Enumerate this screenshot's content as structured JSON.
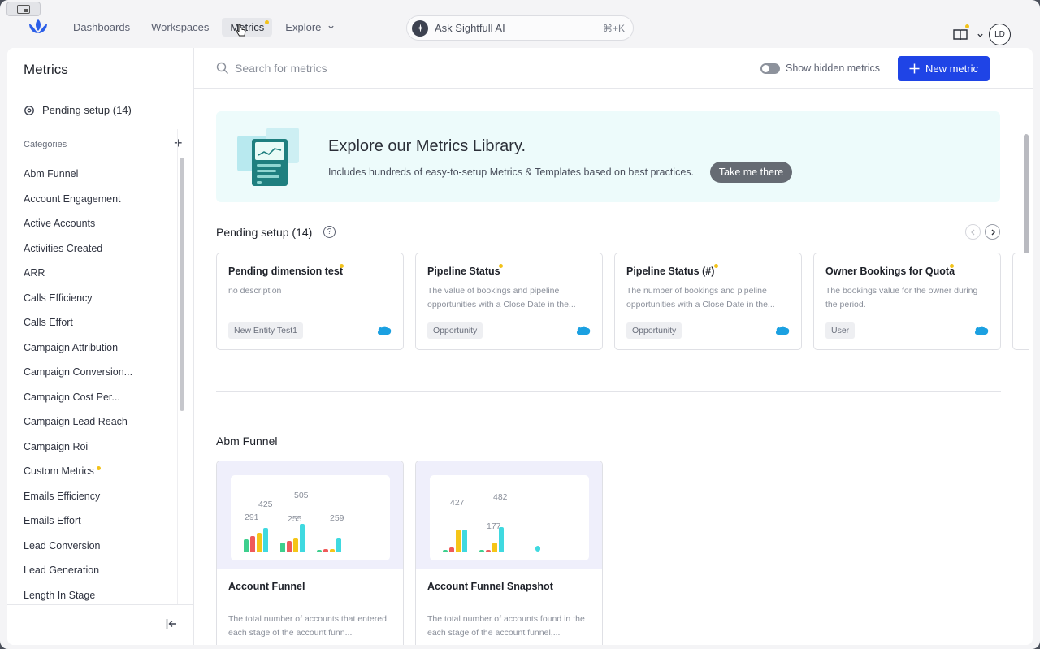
{
  "nav": {
    "links": [
      "Dashboards",
      "Workspaces",
      "Metrics",
      "Explore"
    ],
    "ask_label": "Ask Sightfull AI",
    "ask_shortcut": "⌘+K",
    "avatar_initials": "LD"
  },
  "sidebar": {
    "title": "Metrics",
    "pending": "Pending setup (14)",
    "categories_heading": "Categories",
    "items": [
      "Abm Funnel",
      "Account Engagement",
      "Active Accounts",
      "Activities Created",
      "ARR",
      "Calls Efficiency",
      "Calls Effort",
      "Campaign Attribution",
      "Campaign Conversion...",
      "Campaign Cost Per...",
      "Campaign Lead Reach",
      "Campaign Roi",
      "Custom Metrics",
      "Emails Efficiency",
      "Emails Effort",
      "Lead Conversion",
      "Lead Generation",
      "Length In Stage"
    ]
  },
  "toolbar": {
    "search_placeholder": "Search for metrics",
    "hidden_label": "Show hidden metrics",
    "new_metric": "New metric"
  },
  "banner": {
    "title": "Explore our Metrics Library.",
    "subtitle": "Includes hundreds of easy-to-setup Metrics & Templates based on best practices.",
    "button": "Take me there"
  },
  "pending_section": {
    "title": "Pending setup (14)",
    "cards": [
      {
        "title": "Pending dimension test",
        "desc": "no description",
        "tag": "New Entity Test1"
      },
      {
        "title": "Pipeline Status",
        "desc": "The value of bookings and pipeline opportunities with a Close Date in the...",
        "tag": "Opportunity"
      },
      {
        "title": "Pipeline Status (#)",
        "desc": "The number of bookings and pipeline opportunities with a Close Date in the...",
        "tag": "Opportunity"
      },
      {
        "title": "Owner Bookings for Quota",
        "desc": "The bookings value for the owner during the period.",
        "tag": "User"
      }
    ]
  },
  "abm_section": {
    "title": "Abm Funnel",
    "cards": [
      {
        "title": "Account Funnel",
        "desc": "The total number of accounts that entered each stage of the account funn...",
        "labels": [
          "425",
          "505",
          "291",
          "255",
          "259"
        ]
      },
      {
        "title": "Account Funnel Snapshot",
        "desc": "The total number of accounts found in the each stage of the account funnel,...",
        "labels": [
          "427",
          "482",
          "177"
        ]
      }
    ]
  },
  "colors": {
    "accent": "#1f44e6",
    "banner_bg": "#edfbfb",
    "dot": "#f2c21a",
    "bar_green": "#3ecf8e",
    "bar_red": "#ef5a5a",
    "bar_yellow": "#f5c518",
    "bar_cyan": "#3fd9e0"
  }
}
